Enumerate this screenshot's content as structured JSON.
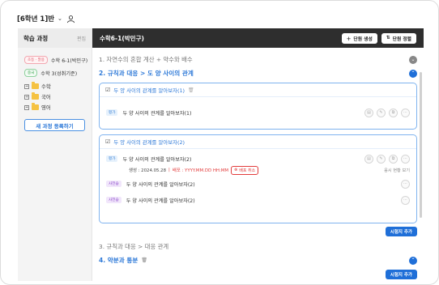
{
  "header": {
    "class_selector": "[6학년 1]반"
  },
  "sidebar": {
    "title": "학습 과정",
    "edit_label": "편집",
    "courses": [
      {
        "tag": "초등 · 말용",
        "name": "수학 6-1(박민구)"
      },
      {
        "tag": "중국",
        "name": "수학 3(성취기준)"
      }
    ],
    "folders": [
      "수학",
      "국어",
      "영어"
    ],
    "new_course_button": "새 과정 등록하기"
  },
  "main": {
    "title": "수학6-1(박민구)",
    "create_unit_button": "단원 생성",
    "sort_unit_button": "단원 정렬",
    "units": [
      {
        "label": "1. 자연수의 혼합 계산 + 약수와 배수"
      },
      {
        "label": "2. 규칙과 대응 > 도 양 사이의 관계"
      },
      {
        "label": "3. 규칙과 대응 > 대응 관계"
      },
      {
        "label": "4. 약분과 통분"
      }
    ],
    "card1": {
      "title": "두 양 사이의 관계를 알아보자(1)",
      "rows": [
        {
          "tag": "평가",
          "text": "두 양 사이의 관계를 알아보자(1)"
        }
      ]
    },
    "card2": {
      "title": "두 양 사이의 관계를 알아보자(2)",
      "rows": [
        {
          "tag": "평가",
          "text": "두 양 사이의 관계를 알아보자(2)"
        },
        {
          "tag": "사전습",
          "text": "두 양 사이의 관계를 알아보자(2)"
        },
        {
          "tag": "사전습",
          "text": "두 양 사이의 관계를 알아보자(2)"
        }
      ],
      "meta_created": "생성 : 2024.05.28",
      "meta_sep": "|",
      "meta_publish": "배포 : YYYY.MM.DD HH:MM",
      "cancel_publish": "배포 취소",
      "see_link": "응시 현황 보기"
    },
    "add_lesson_button": "시험지 추가"
  }
}
